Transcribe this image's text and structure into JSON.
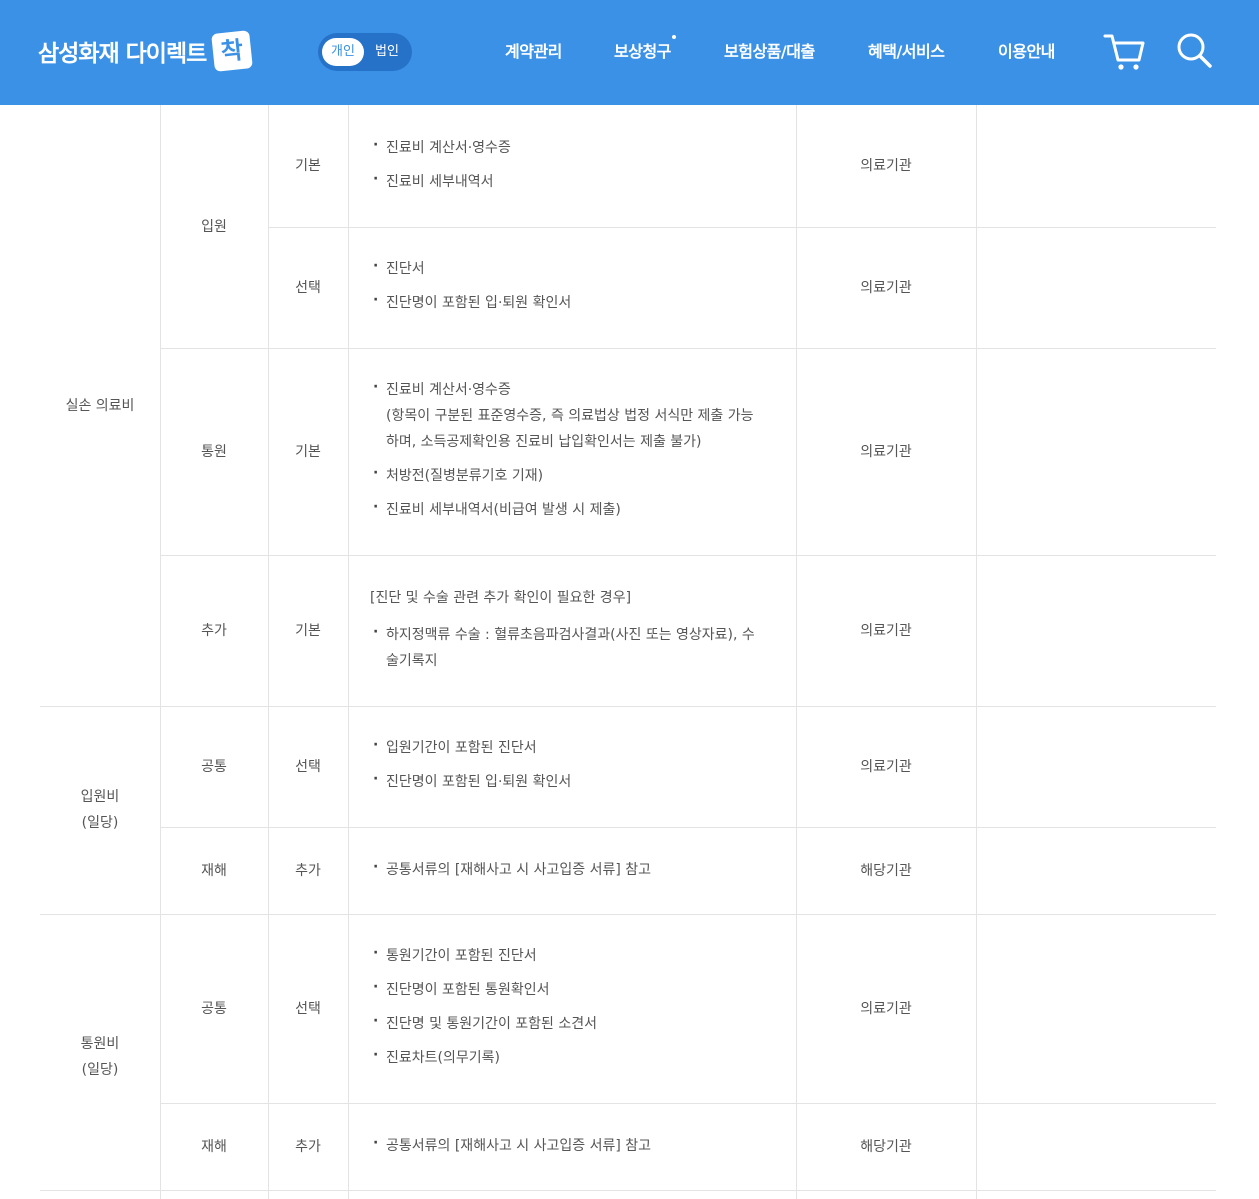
{
  "header": {
    "logo_text": "삼성화재 다이렉트",
    "logo_badge": "착",
    "toggle": {
      "active": "개인",
      "inactive": "법인"
    },
    "nav": [
      "계약관리",
      "보상청구",
      "보험상품/대출",
      "혜택/서비스",
      "이용안내"
    ],
    "icons": [
      "cart-icon",
      "search-icon"
    ]
  },
  "table": {
    "groups": {
      "g1": "실손 의료비",
      "g2": [
        "입원비",
        "(일당)"
      ],
      "g3": [
        "통원비",
        "(일당)"
      ]
    },
    "rows": [
      {
        "sub": "입원",
        "type": "기본",
        "docs": [
          "진료비 계산서·영수증",
          "진료비 세부내역서"
        ],
        "issuer": "의료기관"
      },
      {
        "sub": "",
        "type": "선택",
        "docs": [
          "진단서",
          "진단명이 포함된 입·퇴원 확인서"
        ],
        "issuer": "의료기관"
      },
      {
        "sub": "통원",
        "type": "기본",
        "docs": [
          "진료비 계산서·영수증",
          "(항목이 구분된 표준영수증, 즉 의료법상 법정 서식만 제출 가능",
          "하며, 소득공제확인용 진료비 납입확인서는 제출 불가)",
          "처방전(질병분류기호 기재)",
          "진료비 세부내역서(비급여 발생 시 제출)"
        ],
        "issuer": "의료기관"
      },
      {
        "sub": "추가",
        "type": "기본",
        "heading": "[진단 및 수술 관련 추가 확인이 필요한 경우]",
        "docs": [
          "하지정맥류 수술 : 혈류초음파검사결과(사진 또는 영상자료), 수",
          "술기록지"
        ],
        "issuer": "의료기관"
      },
      {
        "sub": "공통",
        "type": "선택",
        "docs": [
          "입원기간이 포함된 진단서",
          "진단명이 포함된 입·퇴원 확인서"
        ],
        "issuer": "의료기관"
      },
      {
        "sub": "재해",
        "type": "추가",
        "docs": [
          "공통서류의 [재해사고 시 사고입증 서류] 참고"
        ],
        "issuer": "해당기관"
      },
      {
        "sub": "공통",
        "type": "선택",
        "docs": [
          "통원기간이 포함된 진단서",
          "진단명이 포함된 통원확인서",
          "진단명 및 통원기간이 포함된 소견서",
          "진료차트(의무기록)"
        ],
        "issuer": "의료기관"
      },
      {
        "sub": "재해",
        "type": "추가",
        "docs": [
          "공통서류의 [재해사고 시 사고입증 서류] 참고"
        ],
        "issuer": "해당기관"
      }
    ]
  }
}
